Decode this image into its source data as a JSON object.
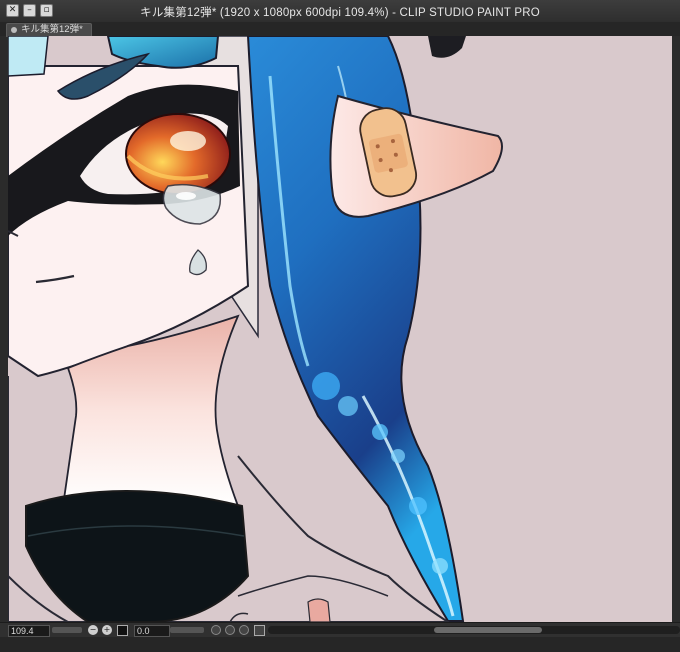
{
  "window": {
    "title": "キル集第12弾* (1920 x 1080px 600dpi 109.4%)  - CLIP STUDIO PAINT PRO",
    "buttons": [
      "close",
      "minimize",
      "maximize"
    ]
  },
  "tab": {
    "label": "キル集第12弾*"
  },
  "canvas": {
    "background": "#d9c9cc",
    "illustration": "anime character close-up with blue hair, orange eye, tear and bandage"
  },
  "statusbar": {
    "zoom": "109.4",
    "rotation": "0.0",
    "zoom_out_label": "−",
    "zoom_in_label": "+",
    "rotate_left_label": "↶",
    "rotate_right_label": "↷"
  },
  "colors": {
    "hair_blue": "#1e73c8",
    "eye_orange": "#e89a22",
    "skin": "#fbeeee",
    "bandage": "#f2c18e"
  }
}
